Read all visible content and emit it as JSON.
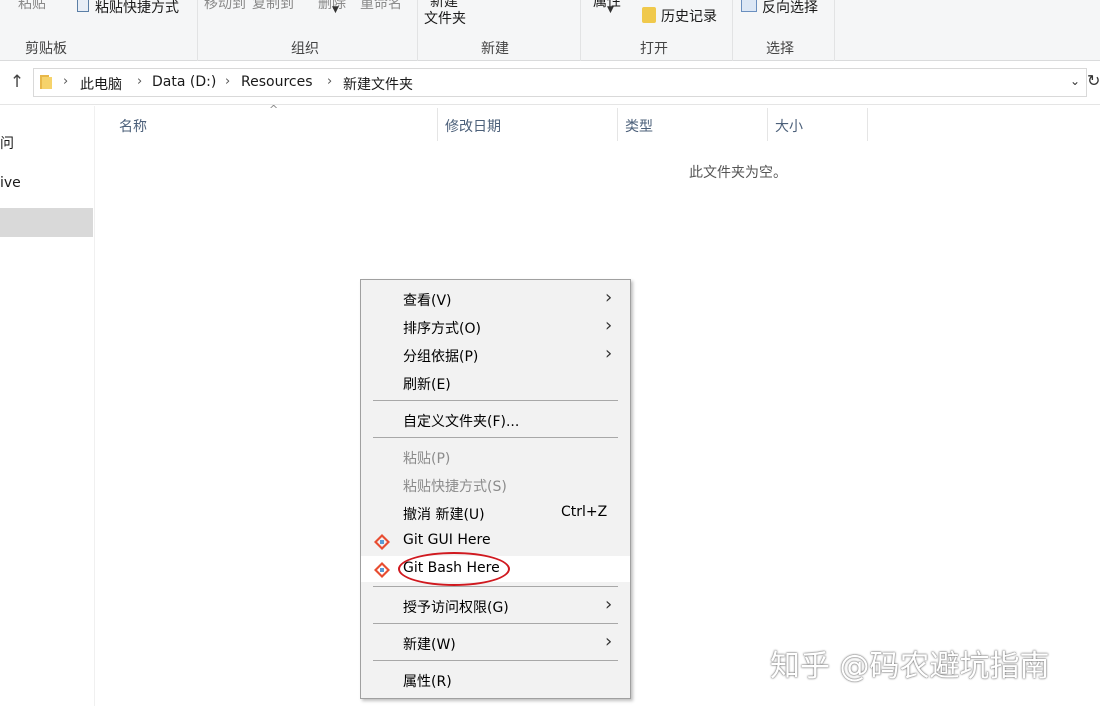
{
  "ribbon": {
    "paste_label": "粘贴",
    "paste_shortcut_label": "粘贴快捷方式",
    "move_to_label": "移动到",
    "copy_to_label": "复制到",
    "delete_label": "删除",
    "rename_label": "重命名",
    "new_folder_line1": "新建",
    "new_folder_line2": "文件夹",
    "properties_label": "属性",
    "history_label": "历史记录",
    "invert_selection_label": "反向选择",
    "groups": {
      "clipboard": "剪贴板",
      "organize": "组织",
      "new": "新建",
      "open": "打开",
      "select": "选择"
    }
  },
  "address": {
    "crumbs": [
      "此电脑",
      "Data (D:)",
      "Resources",
      "新建文件夹"
    ],
    "separator": "›"
  },
  "nav": {
    "items": [
      "问",
      "ive"
    ]
  },
  "columns": {
    "name": "名称",
    "modified": "修改日期",
    "type": "类型",
    "size": "大小"
  },
  "empty_text": "此文件夹为空。",
  "menu": {
    "view": "查看(V)",
    "sort_by": "排序方式(O)",
    "group_by": "分组依据(P)",
    "refresh": "刷新(E)",
    "customize": "自定义文件夹(F)...",
    "paste": "粘贴(P)",
    "paste_shortcut": "粘贴快捷方式(S)",
    "undo_new": "撤消 新建(U)",
    "undo_shortcut": "Ctrl+Z",
    "git_gui": "Git GUI Here",
    "git_bash": "Git Bash Here",
    "give_access": "授予访问权限(G)",
    "new": "新建(W)",
    "properties": "属性(R)"
  },
  "watermark": "知乎 @码农避坑指南",
  "colors": {
    "highlight_circle": "#d0191f",
    "column_header": "#4c607a",
    "menu_bg": "#f2f2f2"
  }
}
